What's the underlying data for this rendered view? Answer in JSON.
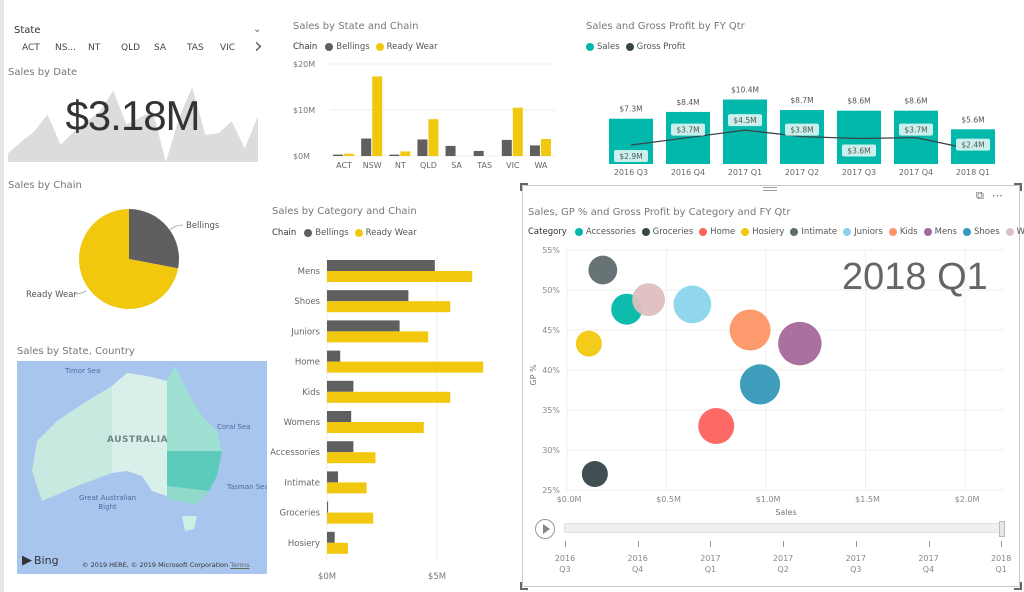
{
  "slicer": {
    "title": "State",
    "items": [
      "ACT",
      "NS...",
      "NT",
      "QLD",
      "SA",
      "TAS",
      "VIC"
    ],
    "chevron_icon": "chevron-down-icon",
    "next_icon": "chevron-right-icon"
  },
  "kpi": {
    "title": "Sales by Date",
    "value": "$3.18M",
    "sparkline": [
      5,
      12,
      18,
      28,
      10,
      18,
      24,
      30,
      42,
      22,
      26,
      30,
      0,
      26,
      44,
      16,
      17,
      24,
      8,
      27
    ]
  },
  "colors": {
    "bellings": "#5f5f5f",
    "ready_wear": "#f2c80f",
    "sales": "#01b8aa",
    "gross_profit": "#374649",
    "label_box": "#c9f0ec"
  },
  "chart_data": [
    {
      "id": "sales-by-state-chain",
      "type": "bar",
      "title": "Sales by State and Chain",
      "legend_title": "Chain",
      "categories": [
        "ACT",
        "NSW",
        "NT",
        "QLD",
        "SA",
        "TAS",
        "VIC",
        "WA"
      ],
      "series": [
        {
          "name": "Bellings",
          "values": [
            0.3,
            3.8,
            0.3,
            3.6,
            2.2,
            1.1,
            3.5,
            2.3
          ]
        },
        {
          "name": "Ready Wear",
          "values": [
            0.5,
            17.3,
            1.0,
            8.0,
            0,
            0,
            10.5,
            3.7
          ]
        }
      ],
      "yticks": [
        "$0M",
        "$10M",
        "$20M"
      ],
      "ylim": [
        0,
        20
      ],
      "grid": true,
      "legend": "top-left"
    },
    {
      "id": "sales-gp-by-qtr",
      "type": "bar",
      "title": "Sales and Gross Profit by FY Qtr",
      "categories": [
        "2016 Q3",
        "2016 Q4",
        "2017 Q1",
        "2017 Q2",
        "2017 Q3",
        "2017 Q4",
        "2018 Q1"
      ],
      "series": [
        {
          "name": "Sales",
          "type": "bar",
          "values": [
            7.3,
            8.4,
            10.4,
            8.7,
            8.6,
            8.6,
            5.6
          ],
          "labels": [
            "$7.3M",
            "$8.4M",
            "$10.4M",
            "$8.7M",
            "$8.6M",
            "$8.6M",
            "$5.6M"
          ]
        },
        {
          "name": "Gross Profit",
          "type": "line",
          "values": [
            2.9,
            3.7,
            4.5,
            3.8,
            3.6,
            3.7,
            2.4
          ],
          "labels": [
            "$2.9M",
            "$3.7M",
            "$4.5M",
            "$3.8M",
            "$3.6M",
            "$3.7M",
            "$2.4M"
          ]
        }
      ],
      "legend": "top-left"
    },
    {
      "id": "sales-by-chain",
      "type": "pie",
      "title": "Sales by Chain",
      "slices": [
        {
          "name": "Bellings",
          "value": 28
        },
        {
          "name": "Ready Wear",
          "value": 72
        }
      ]
    },
    {
      "id": "sales-by-category-chain",
      "type": "bar",
      "orientation": "horizontal",
      "title": "Sales by Category and Chain",
      "legend_title": "Chain",
      "categories": [
        "Mens",
        "Shoes",
        "Juniors",
        "Home",
        "Kids",
        "Womens",
        "Accessories",
        "Intimate",
        "Groceries",
        "Hosiery"
      ],
      "series": [
        {
          "name": "Bellings",
          "values": [
            4.9,
            3.7,
            3.3,
            0.6,
            1.2,
            1.1,
            1.2,
            0.5,
            0.05,
            0.35
          ]
        },
        {
          "name": "Ready Wear",
          "values": [
            6.6,
            5.6,
            4.6,
            7.1,
            5.6,
            4.4,
            2.2,
            1.8,
            2.1,
            0.95
          ]
        }
      ],
      "xticks": [
        "$0M",
        "$5M"
      ],
      "xlim": [
        0,
        7.5
      ],
      "legend": "top-left"
    },
    {
      "id": "sales-gp-scatter",
      "type": "scatter",
      "title": "Sales, GP % and Gross Profit by Category and FY Qtr",
      "legend_title": "Category",
      "xlabel": "Sales",
      "ylabel": "GP %",
      "xlim": [
        0,
        2.2
      ],
      "ylim": [
        25,
        55
      ],
      "xticks": [
        "$0.0M",
        "$0.5M",
        "$1.0M",
        "$1.5M",
        "$2.0M"
      ],
      "yticks": [
        "25%",
        "30%",
        "35%",
        "40%",
        "45%",
        "50%",
        "55%"
      ],
      "play_axis_label": "2018 Q1",
      "points": [
        {
          "name": "Accessories",
          "x": 0.3,
          "y": 47.6,
          "size": 0.13,
          "color": "#01b8aa"
        },
        {
          "name": "Groceries",
          "x": 0.14,
          "y": 27.0,
          "size": 0.05,
          "color": "#374649"
        },
        {
          "name": "Home",
          "x": 0.75,
          "y": 33.0,
          "size": 0.25,
          "color": "#fd625e"
        },
        {
          "name": "Hosiery",
          "x": 0.11,
          "y": 43.3,
          "size": 0.05,
          "color": "#f2c80f"
        },
        {
          "name": "Intimate",
          "x": 0.18,
          "y": 52.5,
          "size": 0.09,
          "color": "#5f6b6d"
        },
        {
          "name": "Juniors",
          "x": 0.63,
          "y": 48.2,
          "size": 0.3,
          "color": "#8ad4eb"
        },
        {
          "name": "Kids",
          "x": 0.92,
          "y": 45.0,
          "size": 0.41,
          "color": "#fe9666"
        },
        {
          "name": "Mens",
          "x": 1.17,
          "y": 43.3,
          "size": 0.5,
          "color": "#a66999"
        },
        {
          "name": "Shoes",
          "x": 0.97,
          "y": 38.2,
          "size": 0.38,
          "color": "#3599b8"
        },
        {
          "name": "Womens",
          "x": 0.41,
          "y": 48.8,
          "size": 0.17,
          "color": "#dfbfbf"
        }
      ],
      "legend": "top-left"
    }
  ],
  "map": {
    "title": "Sales by State, Country",
    "labels": {
      "timor": "Timor Sea",
      "coral": "Coral Sea",
      "country": "AUSTRALIA",
      "bight": "Great Australian\nBight",
      "tasman": "Tasman Sea"
    },
    "bing": "Bing",
    "copyright": "© 2019 HERE, © 2019 Microsoft Corporation",
    "terms": "Terms"
  },
  "focus_visual": {
    "expand_icon": "focus-mode-icon",
    "more_icon": "more-options-icon",
    "timeline": [
      "2016\nQ3",
      "2016\nQ4",
      "2017\nQ1",
      "2017\nQ2",
      "2017\nQ3",
      "2017\nQ4",
      "2018\nQ1"
    ]
  }
}
